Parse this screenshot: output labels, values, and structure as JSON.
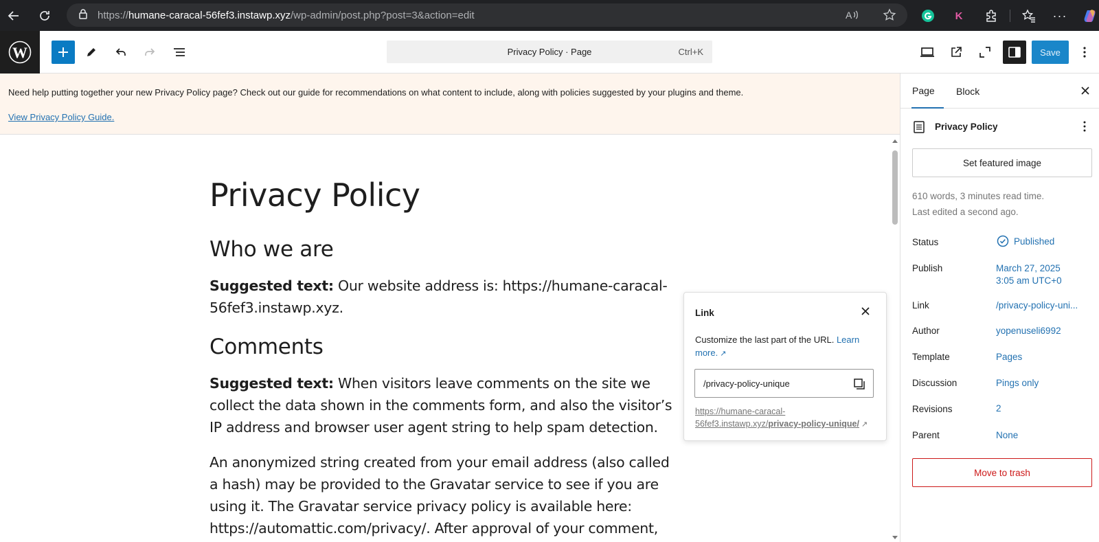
{
  "browser": {
    "url_scheme": "https://",
    "url_host": "humane-caracal-56fef3.instawp.xyz",
    "url_path": "/wp-admin/post.php?post=3&action=edit",
    "extensions": [
      "grammarly-icon",
      "k-extension-icon",
      "puzzle-icon"
    ]
  },
  "toolbar": {
    "command_title": "Privacy Policy · Page",
    "command_shortcut": "Ctrl+K",
    "save_label": "Save"
  },
  "notice": {
    "text": "Need help putting together your new Privacy Policy page? Check out our guide for recommendations on what content to include, along with policies suggested by your plugins and theme.",
    "link": "View Privacy Policy Guide."
  },
  "content": {
    "title": "Privacy Policy",
    "h_who": "Who we are",
    "who_bold": "Suggested text:",
    "who_line1": " Our website address is: https://humane-caracal-",
    "who_line2": "56fef3.instawp.xyz.",
    "h_comments": "Comments",
    "comments_bold": "Suggested text:",
    "comments_line1": " When visitors leave comments on the site we",
    "comments_line2": "collect the data shown in the comments form, and also the visitor’s",
    "comments_line3": "IP address and browser user agent string to help spam detection.",
    "anon_line1": "An anonymized string created from your email address (also called",
    "anon_line2": "a hash) may be provided to the Gravatar service to see if you are",
    "anon_line3": "using it. The Gravatar service privacy policy is available here:",
    "anon_line4": "https://automattic.com/privacy/. After approval of your comment,"
  },
  "link_popover": {
    "title": "Link",
    "help_text": "Customize the last part of the URL.",
    "learn_more": "Learn more.",
    "slug_value": "/privacy-policy-unique",
    "permalink_base1": "https://humane-caracal-",
    "permalink_base2": "56fef3.instawp.xyz/",
    "permalink_slug": "privacy-policy-unique/"
  },
  "sidebar": {
    "tab_page": "Page",
    "tab_block": "Block",
    "doc_title": "Privacy Policy",
    "featured_image_label": "Set featured image",
    "stats_line": "610 words, 3 minutes read time.",
    "edited_line": "Last edited a second ago.",
    "rows": {
      "status_label": "Status",
      "status_value": "Published",
      "publish_label": "Publish",
      "publish_value1": "March 27, 2025",
      "publish_value2": "3:05 am UTC+0",
      "link_label": "Link",
      "link_value": "/privacy-policy-uni...",
      "author_label": "Author",
      "author_value": "yopenuseli6992",
      "template_label": "Template",
      "template_value": "Pages",
      "discussion_label": "Discussion",
      "discussion_value": "Pings only",
      "revisions_label": "Revisions",
      "revisions_value": "2",
      "parent_label": "Parent",
      "parent_value": "None"
    },
    "trash_label": "Move to trash"
  },
  "colors": {
    "accent": "#2271b1",
    "trash_red": "#cc1818",
    "notice_bg": "#fef5ed"
  }
}
